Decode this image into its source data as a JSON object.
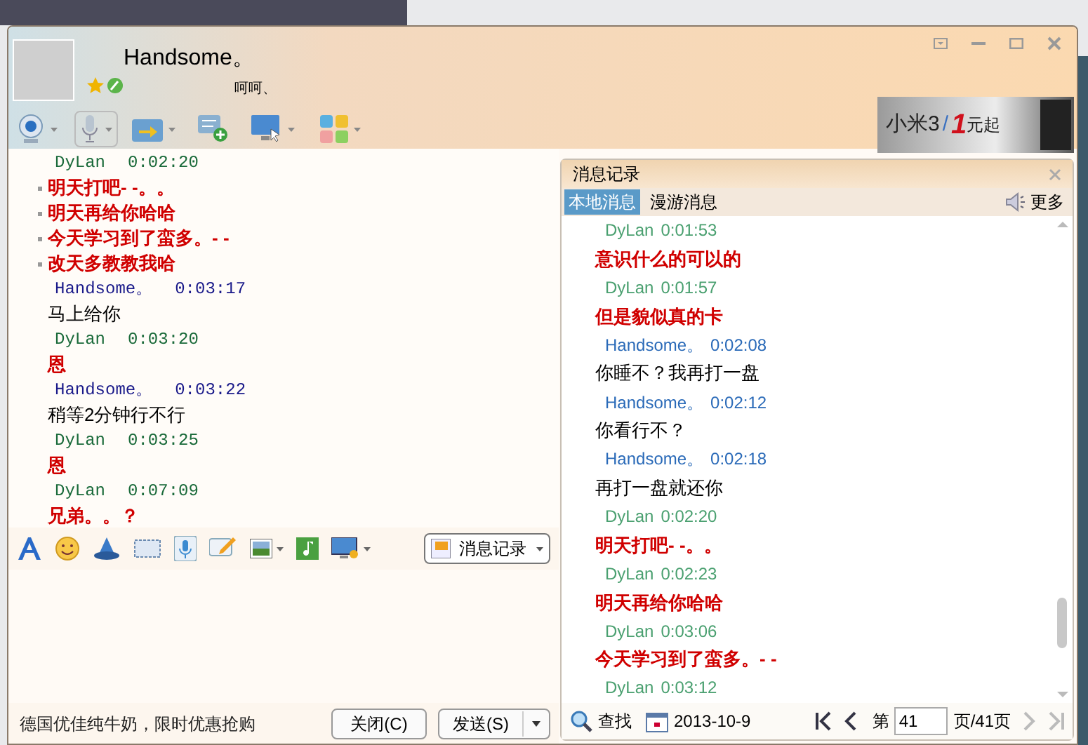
{
  "contact": {
    "name": "Handsome。",
    "signature": "呵呵、"
  },
  "ad_banner": {
    "model": "小米3",
    "separator": "/",
    "price": "1",
    "suffix": "元起"
  },
  "chat": [
    {
      "kind": "peer",
      "sender": "DyLan",
      "time": "0:02:20",
      "bulleted": true,
      "lines": [
        "明天打吧- -。。",
        "明天再给你哈哈",
        "今天学习到了蛮多。- -",
        "改天多教教我哈"
      ]
    },
    {
      "kind": "self",
      "sender": "Handsome。",
      "time": "0:03:17",
      "bulleted": false,
      "lines": [
        "马上给你"
      ]
    },
    {
      "kind": "peer",
      "sender": "DyLan",
      "time": "0:03:20",
      "bulleted": false,
      "lines": [
        "恩"
      ]
    },
    {
      "kind": "self",
      "sender": "Handsome。",
      "time": "0:03:22",
      "bulleted": false,
      "lines": [
        "稍等2分钟行不行"
      ]
    },
    {
      "kind": "peer",
      "sender": "DyLan",
      "time": "0:03:25",
      "bulleted": false,
      "lines": [
        "恩"
      ]
    },
    {
      "kind": "peer",
      "sender": "DyLan",
      "time": "0:07:09",
      "bulleted": false,
      "lines": [
        "兄弟。。？"
      ]
    }
  ],
  "history_button": "消息记录",
  "footer": {
    "ad_text": "德国优佳纯牛奶，限时优惠抢购",
    "close_button": "关闭(C)",
    "send_button": "发送(S)"
  },
  "history": {
    "title": "消息记录",
    "tabs": [
      {
        "label": "本地消息",
        "selected": true
      },
      {
        "label": "漫游消息",
        "selected": false
      }
    ],
    "more": "更多",
    "entries": [
      {
        "kind": "peer",
        "sender": "DyLan",
        "time": "0:01:53",
        "lines": [
          "意识什么的可以的"
        ]
      },
      {
        "kind": "peer",
        "sender": "DyLan",
        "time": "0:01:57",
        "lines": [
          "但是貌似真的卡"
        ]
      },
      {
        "kind": "self",
        "sender": "Handsome。",
        "time": "0:02:08",
        "lines": [
          "你睡不？我再打一盘"
        ]
      },
      {
        "kind": "self",
        "sender": "Handsome。",
        "time": "0:02:12",
        "lines": [
          "你看行不？"
        ]
      },
      {
        "kind": "self",
        "sender": "Handsome。",
        "time": "0:02:18",
        "lines": [
          "再打一盘就还你"
        ]
      },
      {
        "kind": "peer",
        "sender": "DyLan",
        "time": "0:02:20",
        "lines": [
          "明天打吧- -。。"
        ]
      },
      {
        "kind": "peer",
        "sender": "DyLan",
        "time": "0:02:23",
        "lines": [
          "明天再给你哈哈"
        ]
      },
      {
        "kind": "peer",
        "sender": "DyLan",
        "time": "0:03:06",
        "lines": [
          "今天学习到了蛮多。- -"
        ]
      },
      {
        "kind": "peer",
        "sender": "DyLan",
        "time": "0:03:12"
      }
    ],
    "search": "查找",
    "date": "2013-10-9",
    "pager": {
      "prefix": "第",
      "page": "41",
      "suffix": "页/41页"
    }
  }
}
